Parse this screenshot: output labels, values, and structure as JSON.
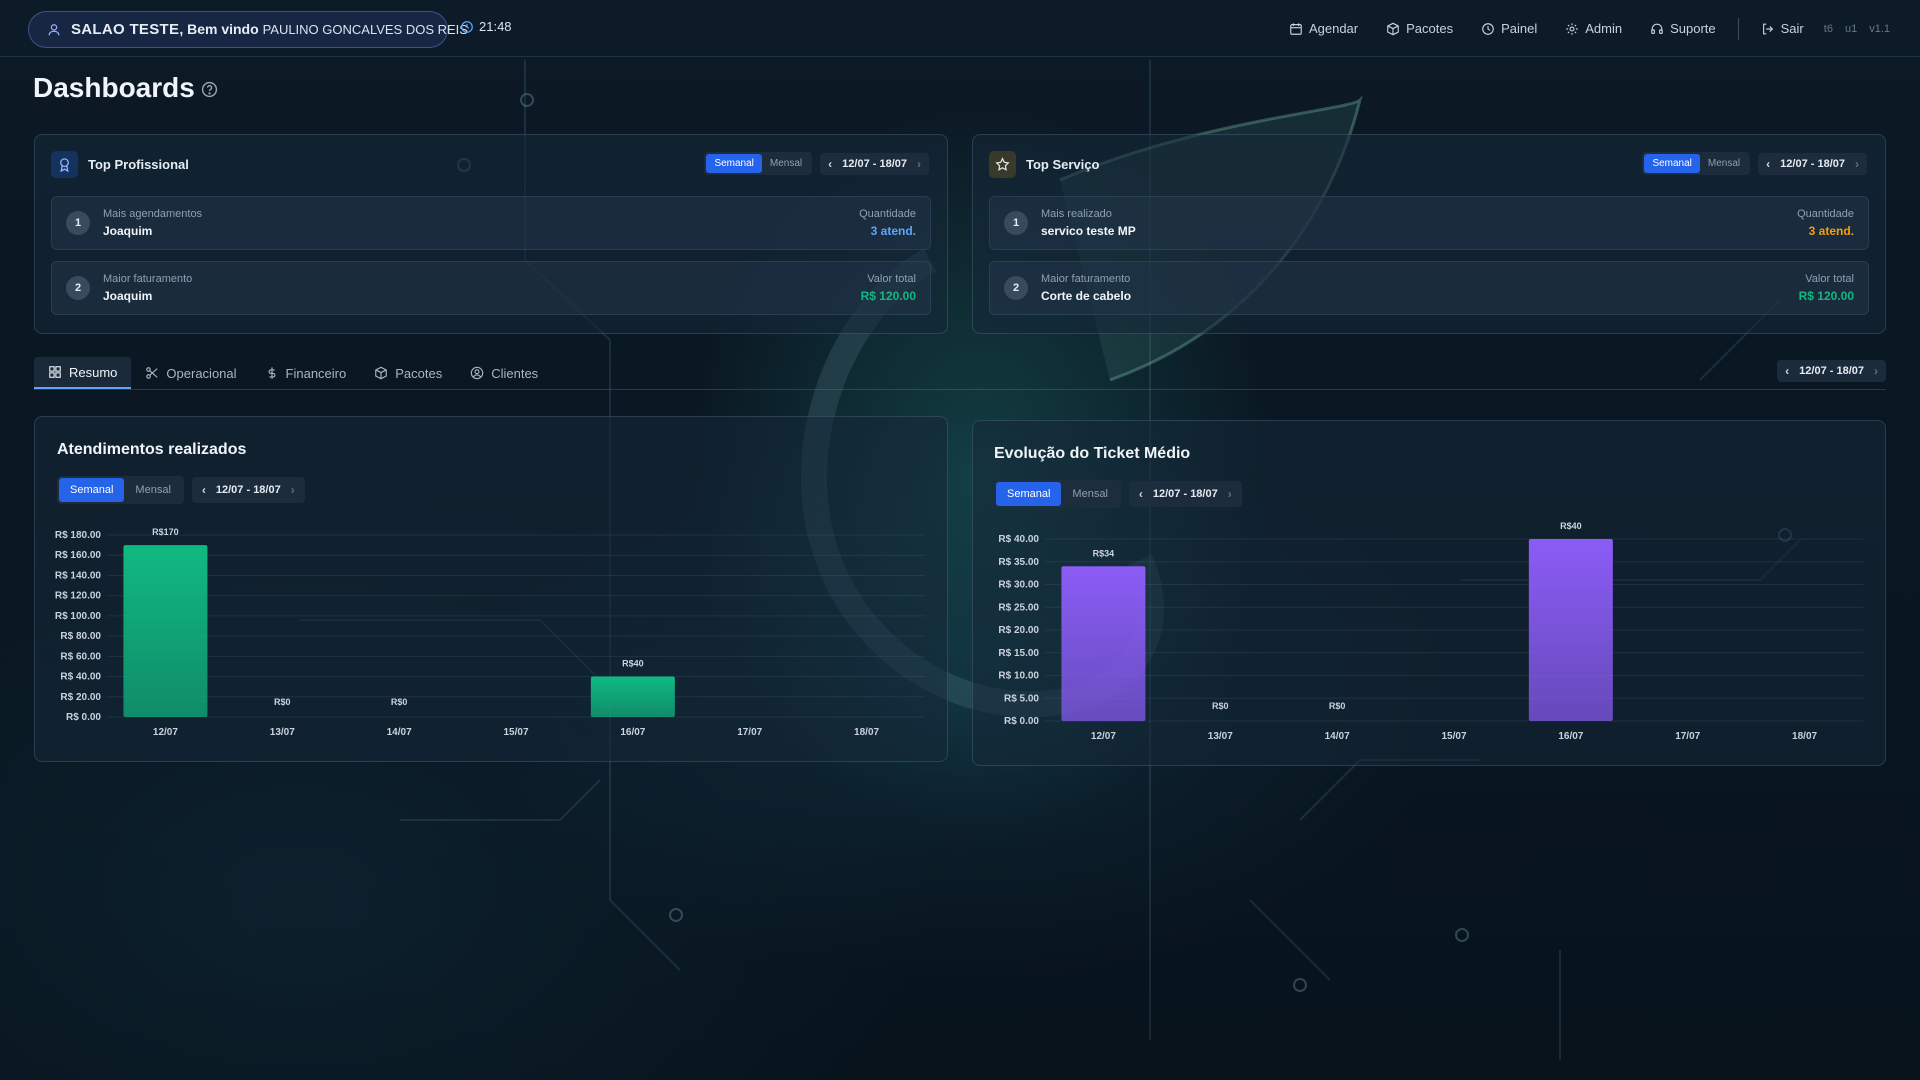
{
  "header": {
    "salon": "SALAO TESTE",
    "welcome": ", Bem vindo",
    "user_name": "PAULINO GONCALVES DOS REIS",
    "time": "21:48",
    "nav": [
      {
        "label": "Agendar",
        "icon": "calendar-icon"
      },
      {
        "label": "Pacotes",
        "icon": "package-icon"
      },
      {
        "label": "Painel",
        "icon": "clock-icon"
      },
      {
        "label": "Admin",
        "icon": "gear-icon"
      },
      {
        "label": "Suporte",
        "icon": "headset-icon"
      }
    ],
    "logout": "Sair",
    "versions": [
      "t6",
      "u1",
      "v1.1"
    ]
  },
  "page": {
    "title": "Dashboards"
  },
  "toggle": {
    "weekly": "Semanal",
    "monthly": "Mensal"
  },
  "top_professional": {
    "title": "Top Profissional",
    "range": "12/07 - 18/07",
    "rows": [
      {
        "rank": "1",
        "label": "Mais agendamentos",
        "name": "Joaquim",
        "value_label": "Quantidade",
        "value": "3 atend."
      },
      {
        "rank": "2",
        "label": "Maior faturamento",
        "name": "Joaquim",
        "value_label": "Valor total",
        "value": "R$ 120.00"
      }
    ]
  },
  "top_service": {
    "title": "Top Serviço",
    "range": "12/07 - 18/07",
    "rows": [
      {
        "rank": "1",
        "label": "Mais realizado",
        "name": "servico teste MP",
        "value_label": "Quantidade",
        "value": "3 atend."
      },
      {
        "rank": "2",
        "label": "Maior faturamento",
        "name": "Corte de cabelo",
        "value_label": "Valor total",
        "value": "R$ 120.00"
      }
    ]
  },
  "tabs": [
    "Resumo",
    "Operacional",
    "Financeiro",
    "Pacotes",
    "Clientes"
  ],
  "tabs_range": "12/07 - 18/07",
  "colors": {
    "accent": "#2563eb",
    "green": "#10b981",
    "purple": "#8b5cf6",
    "blue_value": "#60a5fa",
    "amber_value": "#f59e0b"
  },
  "chart_data": [
    {
      "type": "bar",
      "title": "Atendimentos realizados",
      "range": "12/07 - 18/07",
      "categories": [
        "12/07",
        "13/07",
        "14/07",
        "15/07",
        "16/07",
        "17/07",
        "18/07"
      ],
      "values": [
        170,
        0,
        0,
        null,
        40,
        null,
        null
      ],
      "data_labels": [
        "R$170",
        "R$0",
        "R$0",
        "",
        "R$40",
        "",
        ""
      ],
      "y_ticks": [
        "R$ 0.00",
        "R$ 20.00",
        "R$ 40.00",
        "R$ 60.00",
        "R$ 80.00",
        "R$ 100.00",
        "R$ 120.00",
        "R$ 140.00",
        "R$ 160.00",
        "R$ 180.00"
      ],
      "ylim": [
        0,
        180
      ],
      "color": "#10b981"
    },
    {
      "type": "bar",
      "title": "Evolução do Ticket Médio",
      "range": "12/07 - 18/07",
      "categories": [
        "12/07",
        "13/07",
        "14/07",
        "15/07",
        "16/07",
        "17/07",
        "18/07"
      ],
      "values": [
        34,
        0,
        0,
        null,
        40,
        null,
        null
      ],
      "data_labels": [
        "R$34",
        "R$0",
        "R$0",
        "",
        "R$40",
        "",
        ""
      ],
      "y_ticks": [
        "R$ 0.00",
        "R$ 5.00",
        "R$ 10.00",
        "R$ 15.00",
        "R$ 20.00",
        "R$ 25.00",
        "R$ 30.00",
        "R$ 35.00",
        "R$ 40.00"
      ],
      "ylim": [
        0,
        40
      ],
      "color": "#8b5cf6"
    }
  ]
}
